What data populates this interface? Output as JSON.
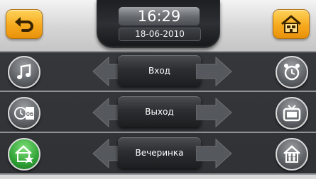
{
  "status": {
    "time": "16:29",
    "date": "18-06-2010"
  },
  "header": {
    "back_icon": "back-arrow-icon",
    "home_icon": "home-icon",
    "accent": "#f5a623"
  },
  "scenarios": [
    {
      "label": "Вход",
      "left_icon": "music-note-icon",
      "right_icon": "alarm-clock-icon"
    },
    {
      "label": "Выход",
      "left_icon": "clock-calendar-icon",
      "calendar_day": "06",
      "right_icon": "tv-icon"
    },
    {
      "label": "Вечеринка",
      "left_icon": "home-star-icon",
      "right_icon": "house-people-icon"
    }
  ],
  "colors": {
    "active_green": "#3fae3a",
    "panel": "#35373b"
  }
}
